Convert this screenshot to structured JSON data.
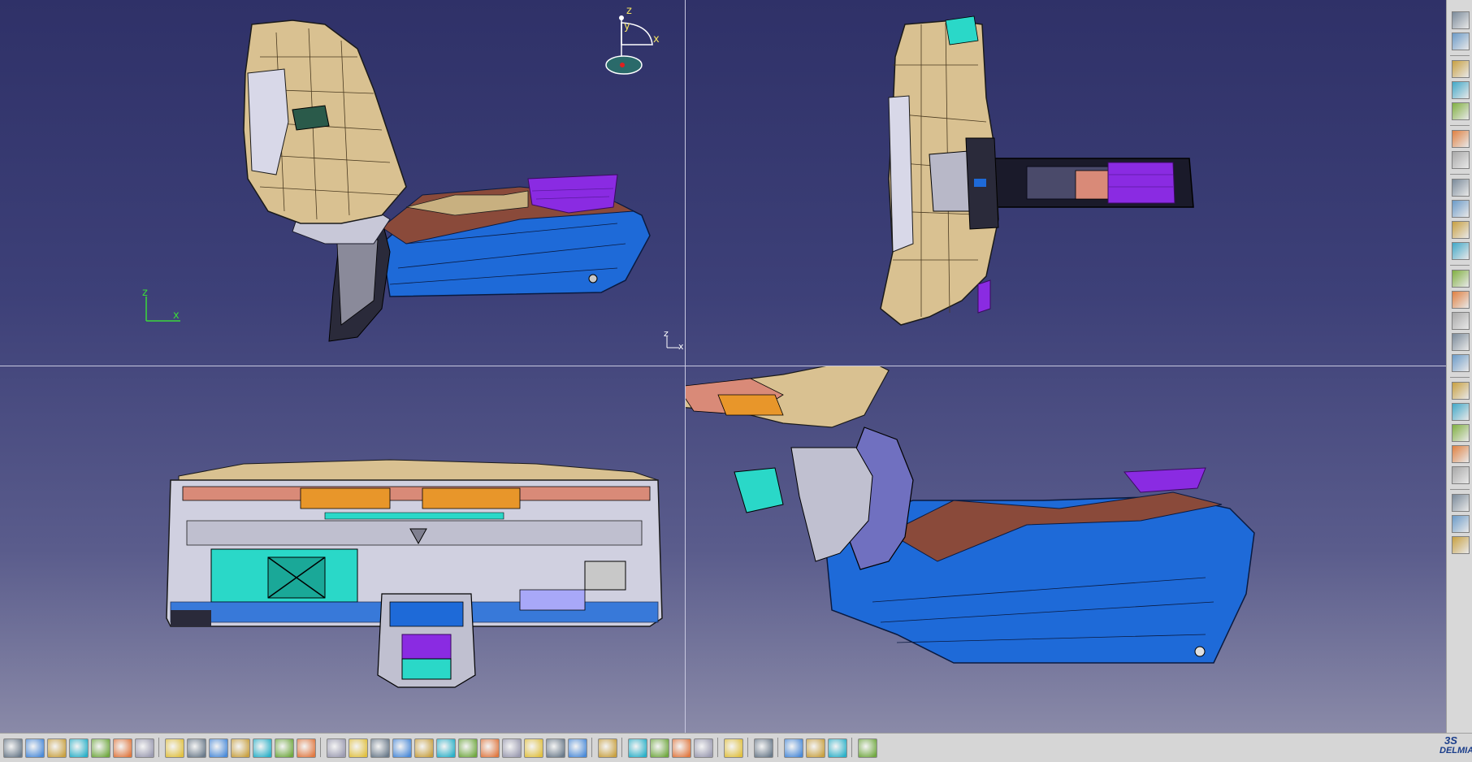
{
  "viewport": {
    "top_left": {
      "compass": {
        "z_label": "z",
        "y_label": "y",
        "x_label": "x"
      },
      "axis": {
        "z_label": "z",
        "x_label": "x"
      },
      "corner_axis": {
        "z_label": "z",
        "x_label": "x"
      }
    }
  },
  "logo": {
    "ds_text": "3S",
    "brand_text": "DELMIA"
  },
  "colors": {
    "background_top": "#2f3168",
    "background_bottom": "#8a8aa8",
    "tan_part": "#d9c191",
    "blue_console": "#1e6ad8",
    "purple_part": "#8a2be2",
    "cyan_part": "#2ad8c8",
    "salmon_part": "#d98a78"
  },
  "right_toolbar": {
    "icons": [
      "settings-icon",
      "file-gear-icon",
      "gear-icon",
      "gear-icon",
      "gear-icon",
      "cursor-icon",
      "grid-gear-icon",
      "gear-icon",
      "gear-icon",
      "gear-icon",
      "arrow-right-icon",
      "swap-icon",
      "catalog-icon",
      "text-icon",
      "assembly-icon",
      "assembly-icon",
      "gear-icon",
      "link-icon",
      "link-icon",
      "link-icon",
      "assembly-icon",
      "assembly-icon",
      "assembly-icon",
      "assembly-icon"
    ]
  },
  "bottom_toolbar": {
    "icons": [
      "print-icon",
      "cut-icon",
      "copy-icon",
      "paste-icon",
      "undo-icon",
      "redo-icon",
      "help-icon",
      "formula-icon",
      "comment-icon",
      "light-icon",
      "table-icon",
      "tree-icon",
      "lock-icon",
      "list-icon",
      "select-icon",
      "fit-all-icon",
      "pan-icon",
      "rotate-icon",
      "zoom-in-icon",
      "zoom-out-icon",
      "normal-view-icon",
      "quick-view-icon",
      "cube-icon",
      "shading-icon",
      "hide-show-icon",
      "swap-space-icon",
      "camera-icon",
      "measure-icon",
      "distance-icon",
      "clash-icon",
      "bottle-icon",
      "spiral-icon",
      "layer-icon",
      "material-icon",
      "render-icon",
      "palette-icon",
      "grid-icon"
    ]
  }
}
